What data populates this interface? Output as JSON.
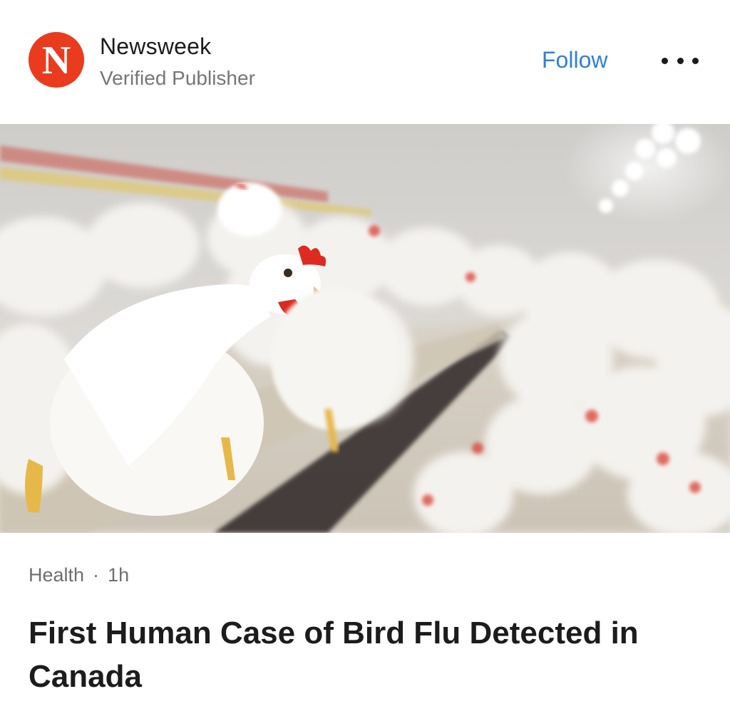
{
  "publisher": {
    "name": "Newsweek",
    "subtitle": "Verified Publisher",
    "logo_letter": "N",
    "logo_color": "#ea3b1f"
  },
  "actions": {
    "follow_label": "Follow",
    "more_icon": "more-horizontal-icon",
    "follow_color": "#2f7fe0"
  },
  "article": {
    "image_subject": "white chickens in a poultry barn",
    "category": "Health",
    "separator": "·",
    "age": "1h",
    "title": "First Human Case of Bird Flu Detected in Canada"
  }
}
